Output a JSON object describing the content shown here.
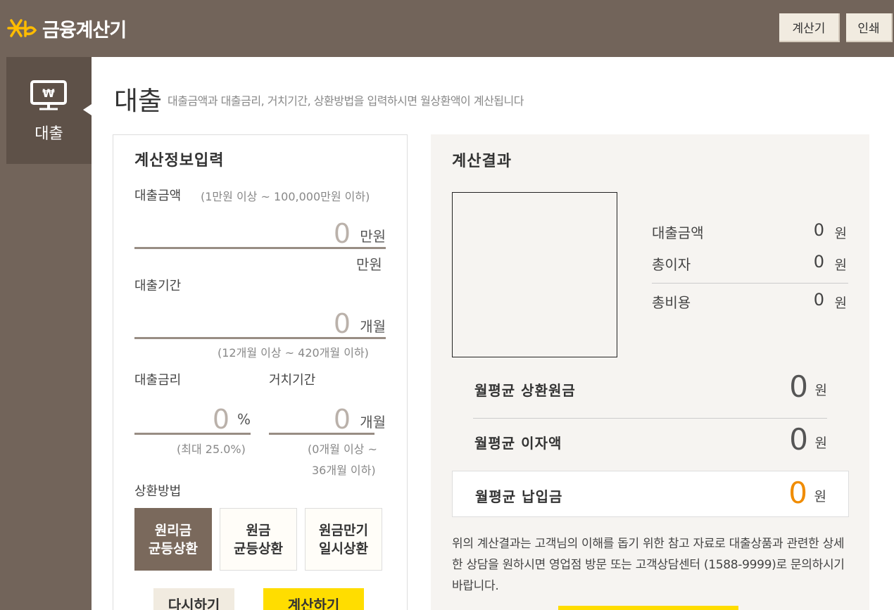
{
  "header": {
    "logo_text": "금융계산기",
    "calc_label": "계산기",
    "print_label": "인쇄"
  },
  "sidebar": {
    "items": [
      {
        "label": "대출",
        "icon": "monitor-won-icon",
        "active": true
      }
    ]
  },
  "page": {
    "title": "대출",
    "description": "대출금액과 대출금리, 거치기간, 상환방법을 입력하시면 월상환액이 계산됩니다"
  },
  "input": {
    "title": "계산정보입력",
    "amount": {
      "label": "대출금액",
      "hint": "(1만원 이상 ~ 100,000만원 이하)",
      "value": "0",
      "unit": "만원",
      "sub_unit": "만원"
    },
    "period": {
      "label": "대출기간",
      "value": "0",
      "unit": "개월",
      "hint": "(12개월 이상 ~ 420개월 이하)"
    },
    "rate": {
      "label": "대출금리",
      "value": "0",
      "unit": "%",
      "hint": "(최대 25.0%)"
    },
    "grace": {
      "label": "거치기간",
      "value": "0",
      "unit": "개월",
      "hint_line1": "(0개월 이상 ~",
      "hint_line2": "36개월 이하)"
    },
    "method": {
      "label": "상환방법",
      "options": [
        {
          "line1": "원리금",
          "line2": "균등상환",
          "active": true
        },
        {
          "line1": "원금",
          "line2": "균등상환",
          "active": false
        },
        {
          "line1": "원금만기",
          "line2": "일시상환",
          "active": false
        }
      ]
    },
    "reset_label": "다시하기",
    "compute_label": "계산하기"
  },
  "result": {
    "title": "계산결과",
    "summary": [
      {
        "label": "대출금액",
        "value": "0",
        "unit": "원"
      },
      {
        "label": "총이자",
        "value": "0",
        "unit": "원"
      },
      {
        "label": "총비용",
        "value": "0",
        "unit": "원"
      }
    ],
    "avg_principal": {
      "label": "월평균 상환원금",
      "value": "0",
      "unit": "원"
    },
    "avg_interest": {
      "label": "월평균 이자액",
      "value": "0",
      "unit": "원"
    },
    "avg_payment": {
      "label": "월평균 납입금",
      "value": "0",
      "unit": "원"
    },
    "notice": "위의 계산결과는 고객님의 이해를 돕기 위한 참고 자료로 대출상품과 관련한 상세한 상담을 원하시면 영업점 방문 또는 고객상담센터 (1588-9999)로 문의하시기 바랍니다."
  },
  "colors": {
    "brand_bg": "#72645a",
    "active_method": "#7a695c",
    "compute_button": "#ffdd00",
    "payment_highlight": "#f08c00"
  }
}
